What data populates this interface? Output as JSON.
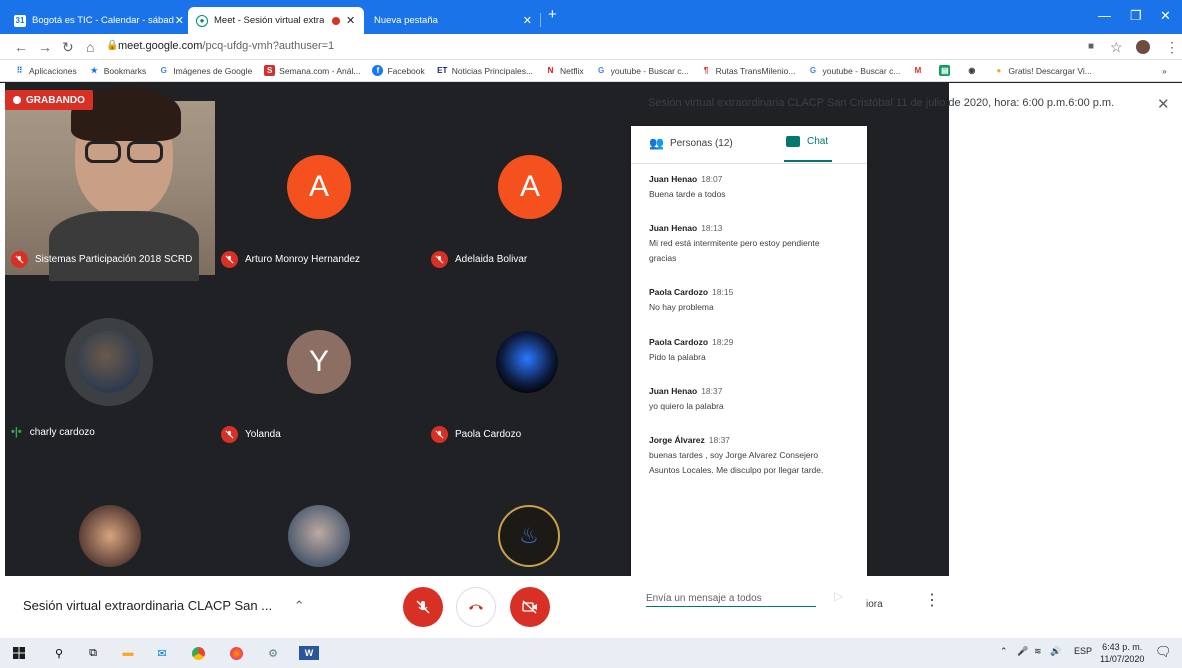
{
  "browser": {
    "tabs": [
      {
        "label": "Bogotá es TIC - Calendar - sábad",
        "icon": "calendar-icon"
      },
      {
        "label": "Meet - Sesión virtual extraor",
        "icon": "meet-icon"
      },
      {
        "label": "Nueva pestaña",
        "icon": ""
      }
    ],
    "url_domain": "meet.google.com",
    "url_path": "/pcq-ufdg-vmh?authuser=1",
    "bookmarks": [
      "Aplicaciones",
      "Bookmarks",
      "Imágenes de Google",
      "Semana.com - Anál...",
      "Facebook",
      "Noticias Principales...",
      "Netflix",
      "youtube - Buscar c...",
      "Rutas TransMilenio...",
      "youtube - Buscar c...",
      "Gratis! Descargar Vi..."
    ],
    "more_bookmarks": "»"
  },
  "meeting": {
    "recording_label": "GRABANDO",
    "header_title": "Sesión virtual extraordinaria CLACP San Cristóbal 11 de julio de 2020, hora: 6:00 p.m.6:00 p.m.",
    "participants": [
      {
        "name": "Sistemas Participación 2018 SCRD",
        "initial": "",
        "muted": true
      },
      {
        "name": "Arturo Monroy Hernandez",
        "initial": "A",
        "muted": true
      },
      {
        "name": "Adelaida Bolivar",
        "initial": "A",
        "muted": true
      },
      {
        "name": "charly cardozo",
        "initial": "",
        "muted": false
      },
      {
        "name": "Yolanda",
        "initial": "Y",
        "muted": true
      },
      {
        "name": "Paola Cardozo",
        "initial": "",
        "muted": true
      }
    ],
    "bottom_title": "Sesión virtual extraordinaria CLACP San ...",
    "now_label": "iora",
    "colors": {
      "accent": "#1a73e8",
      "danger": "#d93025",
      "chat": "#00796b",
      "avatar_orange": "#f4511e",
      "avatar_brown": "#8d6e63"
    }
  },
  "chat_panel": {
    "people_tab": "Personas (12)",
    "chat_tab": "Chat",
    "messages": [
      {
        "author": "Juan Henao",
        "time": "18:07",
        "lines": [
          "Buena tarde a todos"
        ]
      },
      {
        "author": "Juan Henao",
        "time": "18:13",
        "lines": [
          "Mi red está intermitente pero estoy pendiente",
          "gracias"
        ]
      },
      {
        "author": "Paola Cardozo",
        "time": "18:15",
        "lines": [
          "No hay problema"
        ]
      },
      {
        "author": "Paola Cardozo",
        "time": "18:29",
        "lines": [
          "Pido la palabra"
        ]
      },
      {
        "author": "Juan Henao",
        "time": "18:37",
        "lines": [
          "yo quiero la palabra"
        ]
      },
      {
        "author": "Jorge Álvarez",
        "time": "18:37",
        "lines": [
          "buenas tardes , soy Jorge Alvarez Consejero",
          "Asuntos Locales. Me disculpo por llegar  tarde."
        ]
      }
    ],
    "composer_placeholder": "Envía un mensaje a todos"
  },
  "taskbar": {
    "lang": "ESP",
    "time": "6:43 p. m.",
    "date": "11/07/2020"
  }
}
